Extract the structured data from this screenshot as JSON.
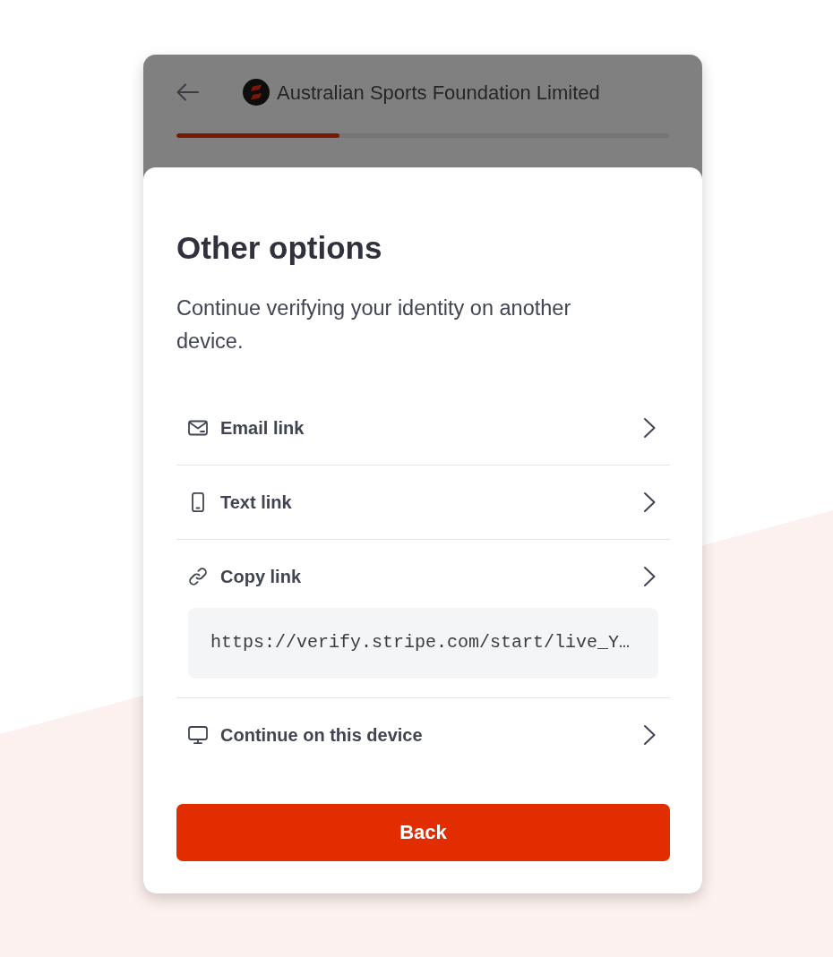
{
  "header": {
    "title": "Australian Sports Foundation Limited",
    "progress": {
      "level": 0.33
    }
  },
  "sheet": {
    "title": "Other options",
    "description": "Continue verifying your identity on another device.",
    "options": [
      {
        "kind": "email",
        "label": "Email link"
      },
      {
        "kind": "phone",
        "label": "Text link"
      },
      {
        "kind": "link",
        "label": "Copy link",
        "url": "https://verify.stripe.com/start/live_Y…"
      },
      {
        "kind": "desktop",
        "label": "Continue on this device"
      }
    ],
    "button": {
      "label": "Back"
    }
  }
}
